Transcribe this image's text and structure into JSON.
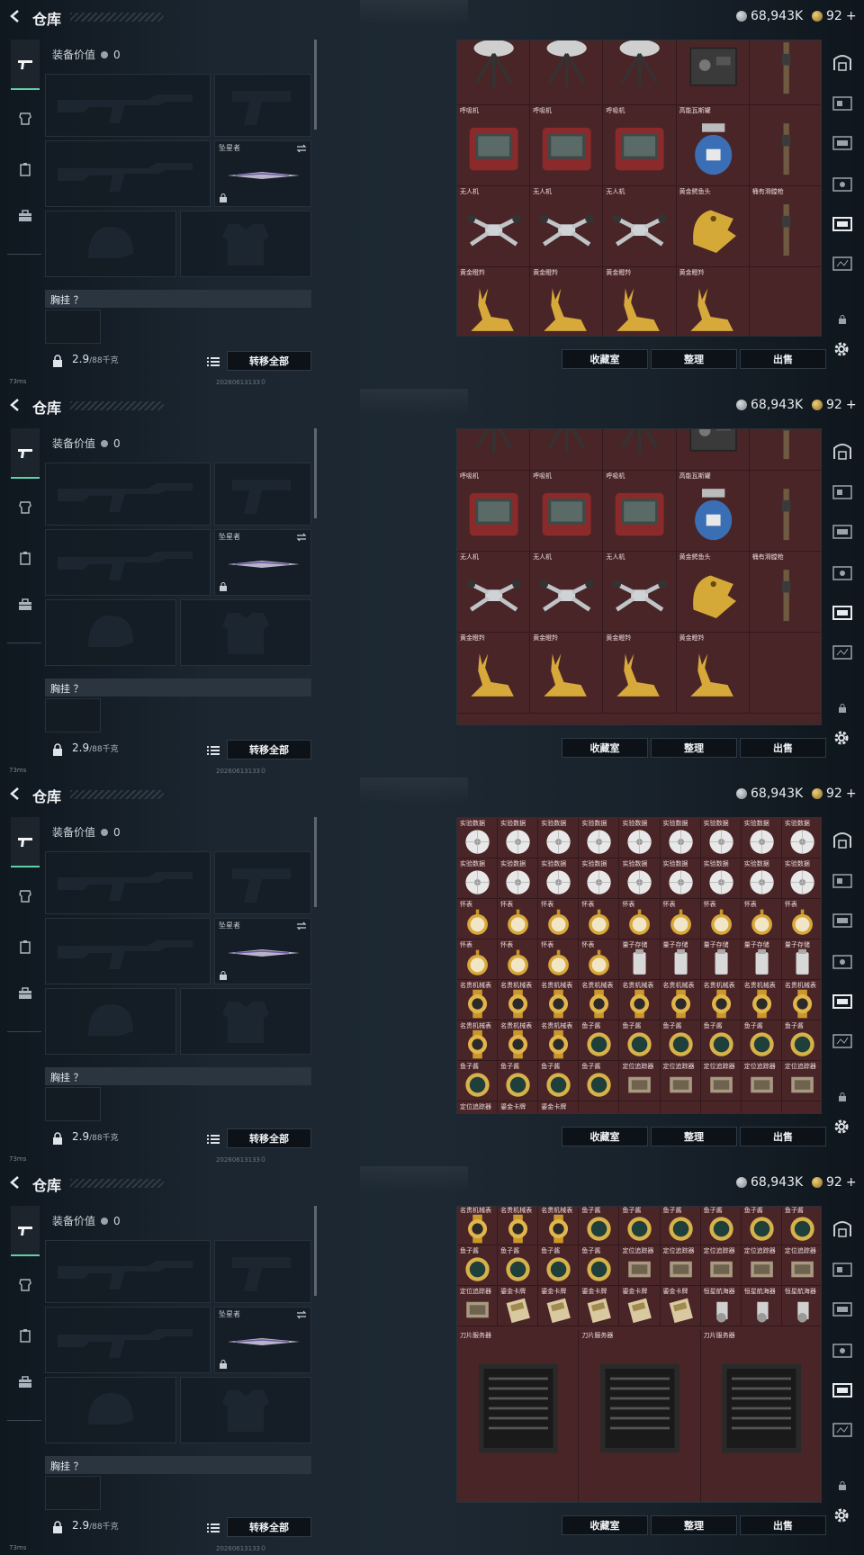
{
  "header": {
    "title": "仓库",
    "currency": "68,943K",
    "tokens": "92",
    "tokens_plus": "+"
  },
  "equipment": {
    "label": "装备价值",
    "value": "0",
    "melee_label": "坠星者",
    "chest_label": "胸挂 ？",
    "weight": "2.9",
    "weight_max": "/88千克",
    "transfer_all": "转移全部"
  },
  "footer_buttons": {
    "collection": "收藏室",
    "organize": "整理",
    "sell": "出售"
  },
  "status": {
    "ping": "73ms",
    "date": "20260613133０"
  },
  "colors": {
    "grid_bg": "#4a2528",
    "accent": "#5fd0a8",
    "gold": "#c9a24a"
  },
  "frames": [
    {
      "cols": 5,
      "rows": 4,
      "offset": -18,
      "cells": [
        [
          "",
          "",
          "",
          "",
          ""
        ],
        [
          "呼吸机",
          "呼吸机",
          "呼吸机",
          "高能瓦斯罐",
          ""
        ],
        [
          "无人机",
          "无人机",
          "无人机",
          "黄金鳄鱼头",
          "桶有滑膛枪"
        ],
        [
          "黄金瞪羚",
          "黄金瞪羚",
          "黄金瞪羚",
          "黄金瞪羚",
          ""
        ]
      ],
      "icons": [
        [
          "dish",
          "dish",
          "dish",
          "radio",
          "rifle"
        ],
        [
          "monitor",
          "monitor",
          "monitor",
          "gascan",
          "rifle"
        ],
        [
          "drone",
          "drone",
          "drone",
          "croc",
          "rifle"
        ],
        [
          "gazelle",
          "gazelle",
          "gazelle",
          "gazelle",
          ""
        ]
      ]
    },
    {
      "cols": 5,
      "rows": 4,
      "offset": -44,
      "cells": [
        [
          "",
          "",
          "",
          "",
          ""
        ],
        [
          "呼吸机",
          "呼吸机",
          "呼吸机",
          "高能瓦斯罐",
          ""
        ],
        [
          "无人机",
          "无人机",
          "无人机",
          "黄金鳄鱼头",
          "桶有滑膛枪"
        ],
        [
          "黄金瞪羚",
          "黄金瞪羚",
          "黄金瞪羚",
          "黄金瞪羚",
          ""
        ]
      ],
      "icons": [
        [
          "dish",
          "dish",
          "dish",
          "radio",
          "rifle"
        ],
        [
          "monitor",
          "monitor",
          "monitor",
          "gascan",
          "rifle"
        ],
        [
          "drone",
          "drone",
          "drone",
          "croc",
          "rifle"
        ],
        [
          "gazelle",
          "gazelle",
          "gazelle",
          "gazelle",
          ""
        ]
      ]
    },
    {
      "cols": 9,
      "rows": 8,
      "offset": 0,
      "cells": [
        [
          "实验数据",
          "实验数据",
          "实验数据",
          "实验数据",
          "实验数据",
          "实验数据",
          "实验数据",
          "实验数据",
          "实验数据"
        ],
        [
          "实验数据",
          "实验数据",
          "实验数据",
          "实验数据",
          "实验数据",
          "实验数据",
          "实验数据",
          "实验数据",
          "实验数据"
        ],
        [
          "怀表",
          "怀表",
          "怀表",
          "怀表",
          "怀表",
          "怀表",
          "怀表",
          "怀表",
          "怀表"
        ],
        [
          "怀表",
          "怀表",
          "怀表",
          "怀表",
          "量子存储",
          "量子存储",
          "量子存储",
          "量子存储",
          "量子存储"
        ],
        [
          "名贵机械表",
          "名贵机械表",
          "名贵机械表",
          "名贵机械表",
          "名贵机械表",
          "名贵机械表",
          "名贵机械表",
          "名贵机械表",
          "名贵机械表"
        ],
        [
          "名贵机械表",
          "名贵机械表",
          "名贵机械表",
          "鱼子酱",
          "鱼子酱",
          "鱼子酱",
          "鱼子酱",
          "鱼子酱",
          "鱼子酱"
        ],
        [
          "鱼子酱",
          "鱼子酱",
          "鱼子酱",
          "鱼子酱",
          "定位追踪器",
          "定位追踪器",
          "定位追踪器",
          "定位追踪器",
          "定位追踪器"
        ],
        [
          "定位追踪器",
          "鎏金卡牌",
          "鎏金卡牌",
          "",
          "",
          "",
          "",
          "",
          ""
        ]
      ],
      "icons": [
        [
          "disc",
          "disc",
          "disc",
          "disc",
          "disc",
          "disc",
          "disc",
          "disc",
          "disc"
        ],
        [
          "disc",
          "disc",
          "disc",
          "disc",
          "disc",
          "disc",
          "disc",
          "disc",
          "disc"
        ],
        [
          "watch",
          "watch",
          "watch",
          "watch",
          "watch",
          "watch",
          "watch",
          "watch",
          "watch"
        ],
        [
          "watch",
          "watch",
          "watch",
          "watch",
          "usb",
          "usb",
          "usb",
          "usb",
          "usb"
        ],
        [
          "goldwatch",
          "goldwatch",
          "goldwatch",
          "goldwatch",
          "goldwatch",
          "goldwatch",
          "goldwatch",
          "goldwatch",
          "goldwatch"
        ],
        [
          "goldwatch",
          "goldwatch",
          "goldwatch",
          "tin",
          "tin",
          "tin",
          "tin",
          "tin",
          "tin"
        ],
        [
          "tin",
          "tin",
          "tin",
          "tin",
          "tracker",
          "tracker",
          "tracker",
          "tracker",
          "tracker"
        ],
        [
          "tracker",
          "card",
          "card",
          "",
          "",
          "",
          "",
          "",
          ""
        ]
      ]
    },
    {
      "cols": 9,
      "rows": 3,
      "offset": -2,
      "cells": [
        [
          "名贵机械表",
          "名贵机械表",
          "名贵机械表",
          "鱼子酱",
          "鱼子酱",
          "鱼子酱",
          "鱼子酱",
          "鱼子酱",
          "鱼子酱"
        ],
        [
          "鱼子酱",
          "鱼子酱",
          "鱼子酱",
          "鱼子酱",
          "定位追踪器",
          "定位追踪器",
          "定位追踪器",
          "定位追踪器",
          "定位追踪器"
        ],
        [
          "定位追踪器",
          "鎏金卡牌",
          "鎏金卡牌",
          "鎏金卡牌",
          "鎏金卡牌",
          "鎏金卡牌",
          "恒星航海器",
          "恒星航海器",
          "恒星航海器"
        ]
      ],
      "icons": [
        [
          "goldwatch",
          "goldwatch",
          "goldwatch",
          "tin",
          "tin",
          "tin",
          "tin",
          "tin",
          "tin"
        ],
        [
          "tin",
          "tin",
          "tin",
          "tin",
          "tracker",
          "tracker",
          "tracker",
          "tracker",
          "tracker"
        ],
        [
          "tracker",
          "card",
          "card",
          "card",
          "card",
          "card",
          "astro",
          "astro",
          "astro"
        ]
      ],
      "servers": [
        "刀片服务器",
        "刀片服务器",
        "刀片服务器"
      ]
    }
  ]
}
